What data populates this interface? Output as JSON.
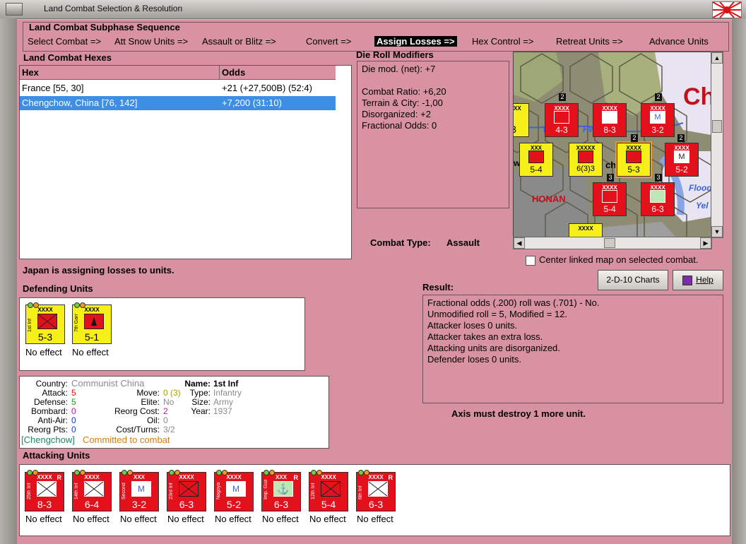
{
  "window": {
    "title": "Land Combat Selection & Resolution"
  },
  "colors": {
    "panel_pink": "#d892a1",
    "unit_red": "#e3111c",
    "unit_yellow": "#f6ef19",
    "selection_blue": "#3d8fe6"
  },
  "subphase": {
    "title": "Land Combat Subphase Sequence",
    "steps": [
      {
        "label": "Select Combat =>",
        "active": false
      },
      {
        "label": "Att Snow Units =>",
        "active": false
      },
      {
        "label": "Assault or Blitz =>",
        "active": false
      },
      {
        "label": "Convert =>",
        "active": false
      },
      {
        "label": "Assign Losses =>",
        "active": true
      },
      {
        "label": "Hex Control =>",
        "active": false
      },
      {
        "label": "Retreat Units =>",
        "active": false
      },
      {
        "label": "Advance Units",
        "active": false
      }
    ]
  },
  "hexes": {
    "title": "Land Combat Hexes",
    "columns": [
      "Hex",
      "Odds"
    ],
    "rows": [
      {
        "hex": "France [55, 30]",
        "odds": "+21 (+27,500B) (52:4)",
        "selected": false
      },
      {
        "hex": "Chengchow, China [76, 142]",
        "odds": "+7,200 (31:10)",
        "selected": true
      }
    ]
  },
  "die_roll": {
    "title": "Die Roll Modifiers",
    "lines": [
      "Die mod. (net): +7",
      "",
      "Combat Ratio: +6,20",
      "Terrain & City: -1,00",
      "Disorganized: +2",
      "Fractional Odds: 0"
    ]
  },
  "combat_type": {
    "label": "Combat Type:",
    "value": "Assault"
  },
  "map": {
    "labels": {
      "city": "Ch",
      "honan": "HONAN",
      "hw": "Hw",
      "ch": "ch",
      "flood": "Flood",
      "yel": "Yel",
      "wa": "wa",
      "ye": "Ye"
    },
    "counters": [
      {
        "size": "XXXX",
        "name": "",
        "str": "3",
        "color": "yellow"
      },
      {
        "size": "XXXX",
        "name": "",
        "str": "4-3",
        "color": "red"
      },
      {
        "size": "XXXX",
        "name": "25th Inf",
        "str": "8-3",
        "color": "red"
      },
      {
        "size": "XXXX",
        "name": "",
        "str": "3-2",
        "color": "red",
        "badge": "M"
      },
      {
        "size": "XXX",
        "name": "2nd Mtn",
        "str": "5-4",
        "color": "yellow"
      },
      {
        "size": "XXXXX",
        "name": "",
        "str": "6(3)3",
        "color": "yellow"
      },
      {
        "size": "XXXX",
        "name": "1st Inf",
        "str": "5-3",
        "color": "yellow"
      },
      {
        "size": "XXXX",
        "name": "Nagoya",
        "str": "5-2",
        "color": "red",
        "badge": "M"
      },
      {
        "size": "XXXX",
        "name": "",
        "str": "5-4",
        "color": "red"
      },
      {
        "size": "XXXX",
        "name": "Imp Guard",
        "str": "6-3",
        "color": "red"
      },
      {
        "size": "XXXX",
        "name": "",
        "str": "",
        "color": "yellow"
      }
    ],
    "stack_badges": [
      "2",
      "2",
      "3",
      "2",
      "2",
      "3"
    ],
    "center_label": "Center linked map on selected combat."
  },
  "assign_msg": "Japan is assigning losses to units.",
  "defending": {
    "title": "Defending Units",
    "units": [
      {
        "size": "XXXX",
        "name": "1st Inf",
        "str": "5-3",
        "effect": "No effect",
        "color": "yellow"
      },
      {
        "size": "XXXX",
        "name": "7th Garr",
        "str": "5-1",
        "effect": "No effect",
        "color": "yellow"
      }
    ]
  },
  "unit_info": {
    "country_label": "Country:",
    "country": "Communist China",
    "attack_label": "Attack:",
    "attack": "5",
    "defense_label": "Defense:",
    "defense": "5",
    "bombard_label": "Bombard:",
    "bombard": "0",
    "antiair_label": "Anti-Air:",
    "antiair": "0",
    "reorg_label": "Reorg Pts:",
    "reorg": "0",
    "move_label": "Move:",
    "move": "0 (3)",
    "elite_label": "Elite:",
    "elite": "No",
    "reorgcost_label": "Reorg Cost:",
    "reorgcost": "2",
    "oil_label": "Oil:",
    "oil": "0",
    "cost_label": "Cost/Turns:",
    "cost": "3/2",
    "name_label": "Name:",
    "name": "1st Inf",
    "type_label": "Type:",
    "type": "Infantry",
    "size_label": "Size:",
    "size": "Army",
    "year_label": "Year:",
    "year": "1937",
    "location": "[Chengchow]",
    "status": "Committed to combat"
  },
  "buttons": {
    "charts": "2-D-10 Charts",
    "help": "Help"
  },
  "result": {
    "title": "Result:",
    "lines": [
      "Fractional odds (.200) roll was (.701)  - No.",
      "Unmodified roll = 5, Modified = 12.",
      "Attacker loses 0 units.",
      "Attacker takes an extra loss.",
      "Attacking units are disorganized.",
      "Defender loses 0 units."
    ]
  },
  "axis_msg": "Axis must destroy 1 more unit.",
  "attacking": {
    "title": "Attacking Units",
    "units": [
      {
        "size": "XXXX",
        "name": "25th Inf",
        "str": "8-3",
        "effect": "No effect",
        "flag": "R",
        "badge": ""
      },
      {
        "size": "XXXX",
        "name": "14th Inf",
        "str": "6-4",
        "effect": "No effect",
        "flag": "",
        "badge": ""
      },
      {
        "size": "XXX",
        "name": "Second",
        "str": "3-2",
        "effect": "No effect",
        "flag": "",
        "badge": "M"
      },
      {
        "size": "XXXX",
        "name": "23rd Inf",
        "str": "6-3",
        "effect": "No effect",
        "flag": "",
        "badge": ""
      },
      {
        "size": "XXXX",
        "name": "Nagoya",
        "str": "5-2",
        "effect": "No effect",
        "flag": "",
        "badge": "M"
      },
      {
        "size": "XXX",
        "name": "Imp. Guard",
        "str": "6-3",
        "effect": "No effect",
        "flag": "R",
        "badge": ""
      },
      {
        "size": "XXXX",
        "name": "12th Inf",
        "str": "5-4",
        "effect": "No effect",
        "flag": "",
        "badge": ""
      },
      {
        "size": "XXXX",
        "name": "6th Inf",
        "str": "6-3",
        "effect": "No effect",
        "flag": "R",
        "badge": ""
      }
    ]
  }
}
